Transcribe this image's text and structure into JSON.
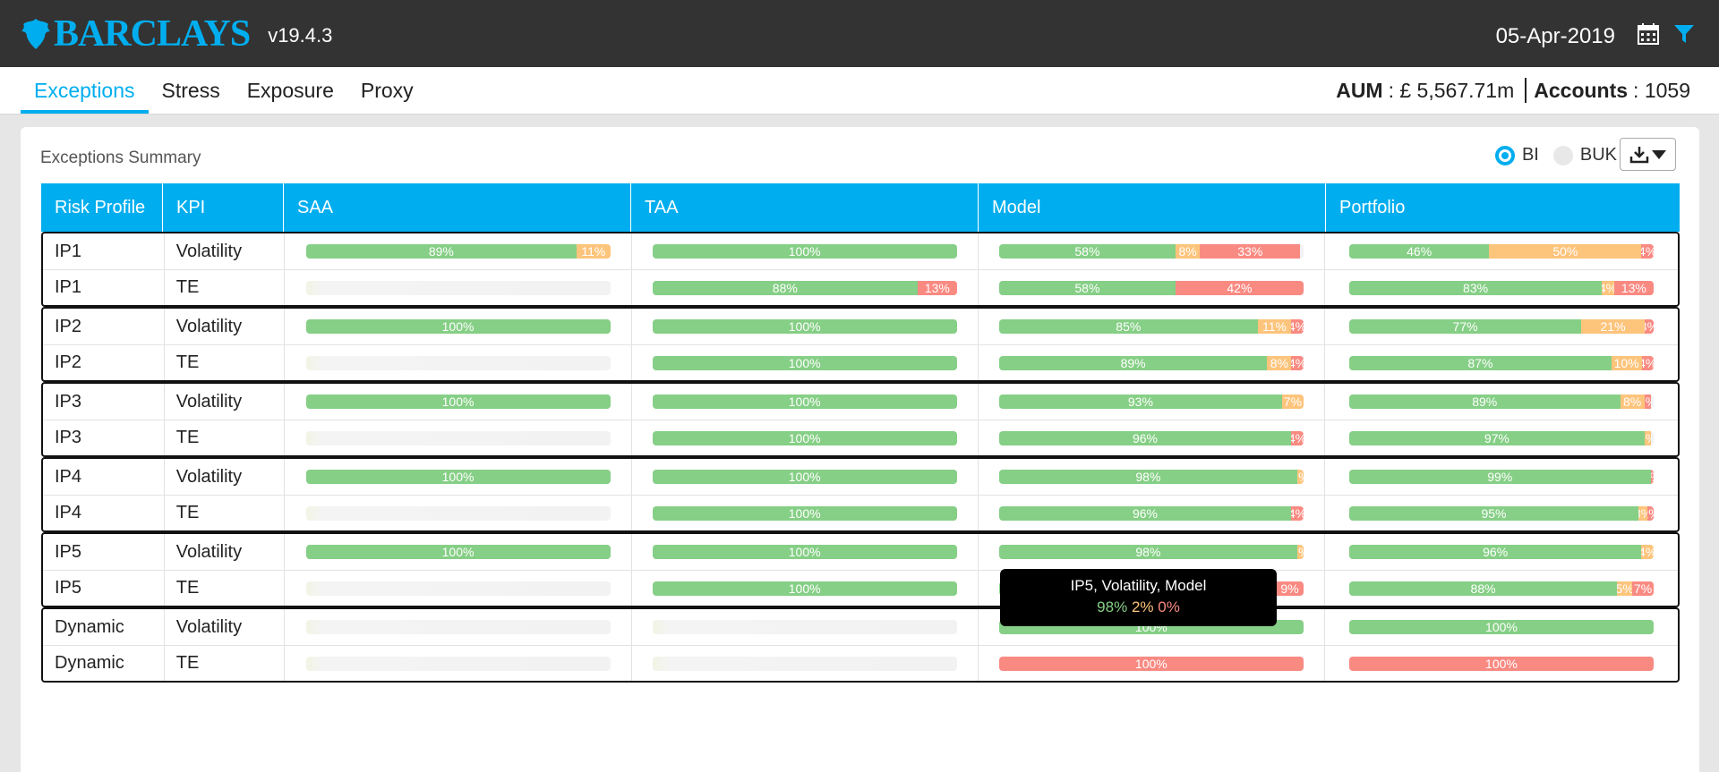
{
  "header": {
    "brand": "BARCLAYS",
    "version": "v19.4.3",
    "date": "05-Apr-2019",
    "icons": [
      "eagle-logo-icon",
      "calendar-icon",
      "filter-icon"
    ],
    "accent_color": "#00aeef"
  },
  "nav": {
    "tabs": [
      {
        "label": "Exceptions",
        "active": true
      },
      {
        "label": "Stress",
        "active": false
      },
      {
        "label": "Exposure",
        "active": false
      },
      {
        "label": "Proxy",
        "active": false
      }
    ],
    "aum_label": "AUM",
    "aum_value": ": £ 5,567.71m",
    "accounts_label": "Accounts",
    "accounts_value": ": 1059"
  },
  "summary": {
    "title": "Exceptions Summary",
    "radio_bi": "BI",
    "radio_buk": "BUK",
    "selected": "BI",
    "columns": [
      "Risk Profile",
      "KPI",
      "SAA",
      "TAA",
      "Model",
      "Portfolio"
    ],
    "colors": {
      "green": "#86cf86",
      "orange": "#fdc47c",
      "red": "#f98a82"
    },
    "groups": [
      {
        "rows": [
          {
            "profile": "IP1",
            "kpi": "Volatility",
            "saa": [
              89,
              11,
              0
            ],
            "taa": [
              100,
              0,
              0
            ],
            "model": [
              58,
              8,
              33
            ],
            "portfolio": [
              46,
              50,
              4
            ]
          },
          {
            "profile": "IP1",
            "kpi": "TE",
            "saa": null,
            "taa": [
              88,
              0,
              13
            ],
            "model": [
              58,
              0,
              42
            ],
            "portfolio": [
              83,
              4,
              13
            ]
          }
        ]
      },
      {
        "rows": [
          {
            "profile": "IP2",
            "kpi": "Volatility",
            "saa": [
              100,
              0,
              0
            ],
            "taa": [
              100,
              0,
              0
            ],
            "model": [
              85,
              11,
              4
            ],
            "portfolio": [
              77,
              21,
              3
            ]
          },
          {
            "profile": "IP2",
            "kpi": "TE",
            "saa": null,
            "taa": [
              100,
              0,
              0
            ],
            "model": [
              89,
              8,
              4
            ],
            "portfolio": [
              87,
              10,
              4
            ]
          }
        ]
      },
      {
        "rows": [
          {
            "profile": "IP3",
            "kpi": "Volatility",
            "saa": [
              100,
              0,
              0
            ],
            "taa": [
              100,
              0,
              0
            ],
            "model": [
              93,
              7,
              0
            ],
            "portfolio": [
              89,
              8,
              2
            ]
          },
          {
            "profile": "IP3",
            "kpi": "TE",
            "saa": null,
            "taa": [
              100,
              0,
              0
            ],
            "model": [
              96,
              0,
              4
            ],
            "portfolio": [
              97,
              2,
              0
            ]
          }
        ]
      },
      {
        "rows": [
          {
            "profile": "IP4",
            "kpi": "Volatility",
            "saa": [
              100,
              0,
              0
            ],
            "taa": [
              100,
              0,
              0
            ],
            "model": [
              98,
              2,
              0
            ],
            "portfolio": [
              99,
              0,
              1
            ]
          },
          {
            "profile": "IP4",
            "kpi": "TE",
            "saa": null,
            "taa": [
              100,
              0,
              0
            ],
            "model": [
              96,
              0,
              4
            ],
            "portfolio": [
              95,
              3,
              2
            ]
          }
        ]
      },
      {
        "rows": [
          {
            "profile": "IP5",
            "kpi": "Volatility",
            "saa": [
              100,
              0,
              0
            ],
            "taa": [
              100,
              0,
              0
            ],
            "model": [
              98,
              2,
              0
            ],
            "portfolio": [
              96,
              4,
              0
            ]
          },
          {
            "profile": "IP5",
            "kpi": "TE",
            "saa": null,
            "taa": [
              100,
              0,
              0
            ],
            "model": [
              91,
              0,
              9
            ],
            "portfolio": [
              88,
              5,
              7
            ]
          }
        ]
      },
      {
        "rows": [
          {
            "profile": "Dynamic",
            "kpi": "Volatility",
            "saa": null,
            "taa": null,
            "model": [
              100,
              0,
              0
            ],
            "portfolio": [
              100,
              0,
              0
            ]
          },
          {
            "profile": "Dynamic",
            "kpi": "TE",
            "saa": null,
            "taa": null,
            "model": [
              0,
              0,
              100
            ],
            "portfolio": [
              0,
              0,
              100
            ]
          }
        ]
      }
    ]
  },
  "tooltip": {
    "title": "IP5, Volatility, Model",
    "green": "98%",
    "orange": "2%",
    "red": "0%"
  }
}
